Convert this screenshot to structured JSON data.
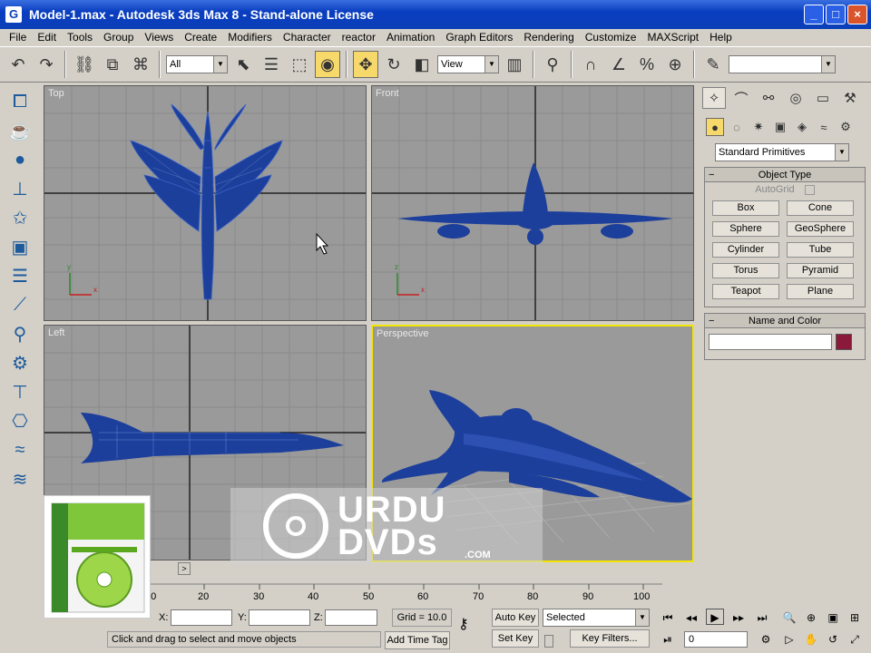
{
  "window": {
    "title": "Model-1.max - Autodesk 3ds Max 8 - Stand-alone License",
    "app_icon": "G"
  },
  "menu": [
    "File",
    "Edit",
    "Tools",
    "Group",
    "Views",
    "Create",
    "Modifiers",
    "Character",
    "reactor",
    "Animation",
    "Graph Editors",
    "Rendering",
    "Customize",
    "MAXScript",
    "Help"
  ],
  "toolbar": {
    "selection_filter": "All",
    "reference_coord": "View"
  },
  "viewports": {
    "top": "Top",
    "front": "Front",
    "left": "Left",
    "perspective": "Perspective"
  },
  "command_panel": {
    "category_dropdown": "Standard Primitives",
    "object_type": {
      "title": "Object Type",
      "autogrid": "AutoGrid",
      "buttons": [
        "Box",
        "Cone",
        "Sphere",
        "GeoSphere",
        "Cylinder",
        "Tube",
        "Torus",
        "Pyramid",
        "Teapot",
        "Plane"
      ]
    },
    "name_color": {
      "title": "Name and Color",
      "name_value": "",
      "swatch_color": "#8b1a3a"
    }
  },
  "timeline": {
    "ticks": [
      "10",
      "20",
      "30",
      "40",
      "50",
      "60",
      "70",
      "80",
      "90",
      "100"
    ],
    "frame_start": 0
  },
  "status": {
    "coord_x_label": "X:",
    "coord_y_label": "Y:",
    "coord_z_label": "Z:",
    "grid": "Grid = 10.0",
    "auto_key": "Auto Key",
    "set_key": "Set Key",
    "selected": "Selected",
    "key_filters": "Key Filters...",
    "prompt": "Click and drag to select and move objects",
    "add_time_tag": "Add Time Tag",
    "frame_value": "0"
  },
  "watermark": {
    "line1": "URDU",
    "line2": "DVDs",
    "suffix": ".COM"
  },
  "colors": {
    "model_blue": "#1d3f9c",
    "viewport_bg": "#9a9a9a",
    "active_border": "#f2e600"
  }
}
